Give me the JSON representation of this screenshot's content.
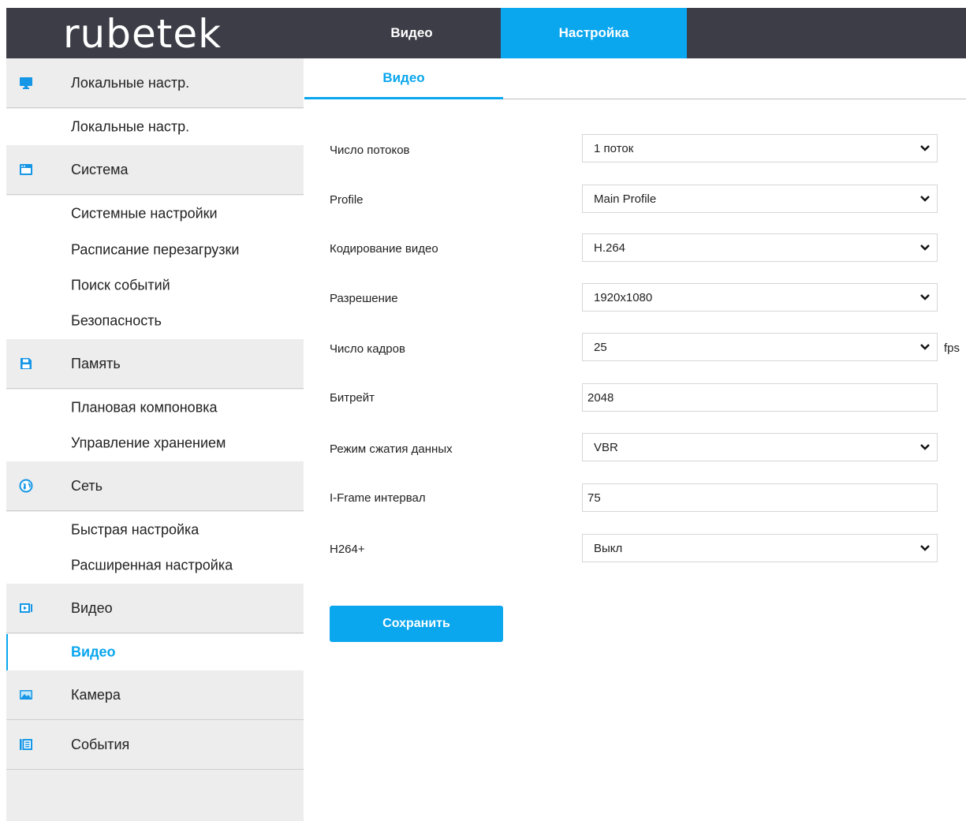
{
  "header": {
    "logo": "rubetek",
    "tabs": [
      {
        "label": "Видео"
      },
      {
        "label": "Настройка"
      }
    ]
  },
  "sidebar": {
    "groups": [
      {
        "label": "Локальные настр.",
        "icon": "monitor-icon",
        "items": [
          "Локальные настр."
        ]
      },
      {
        "label": "Система",
        "icon": "window-icon",
        "items": [
          "Системные настройки",
          "Расписание перезагрузки",
          "Поиск событий",
          "Безопасность"
        ]
      },
      {
        "label": "Память",
        "icon": "floppy-icon",
        "items": [
          "Плановая компоновка",
          "Управление хранением"
        ]
      },
      {
        "label": "Сеть",
        "icon": "globe-icon",
        "items": [
          "Быстрая настройка",
          "Расширенная настройка"
        ]
      },
      {
        "label": "Видео",
        "icon": "video-icon",
        "items": [
          "Видео"
        ]
      },
      {
        "label": "Камера",
        "icon": "image-icon",
        "items": []
      },
      {
        "label": "События",
        "icon": "list-icon",
        "items": []
      }
    ]
  },
  "content": {
    "subtab": "Видео",
    "fields": [
      {
        "label": "Число потоков",
        "type": "select",
        "value": "1 поток"
      },
      {
        "label": "Profile",
        "type": "select",
        "value": "Main Profile"
      },
      {
        "label": "Кодирование видео",
        "type": "select",
        "value": "H.264"
      },
      {
        "label": "Разрешение",
        "type": "select",
        "value": "1920x1080"
      },
      {
        "label": "Число кадров",
        "type": "select",
        "value": "25",
        "unit": "fps"
      },
      {
        "label": "Битрейт",
        "type": "input",
        "value": "2048"
      },
      {
        "label": "Режим сжатия данных",
        "type": "select",
        "value": "VBR"
      },
      {
        "label": "I-Frame интервал",
        "type": "input",
        "value": "75"
      },
      {
        "label": "H264+",
        "type": "select",
        "value": "Выкл"
      }
    ],
    "save_label": "Сохранить"
  },
  "colors": {
    "accent": "#0aa6ee",
    "topbar": "#3d3d47",
    "sidebar_bg": "#ededed"
  }
}
